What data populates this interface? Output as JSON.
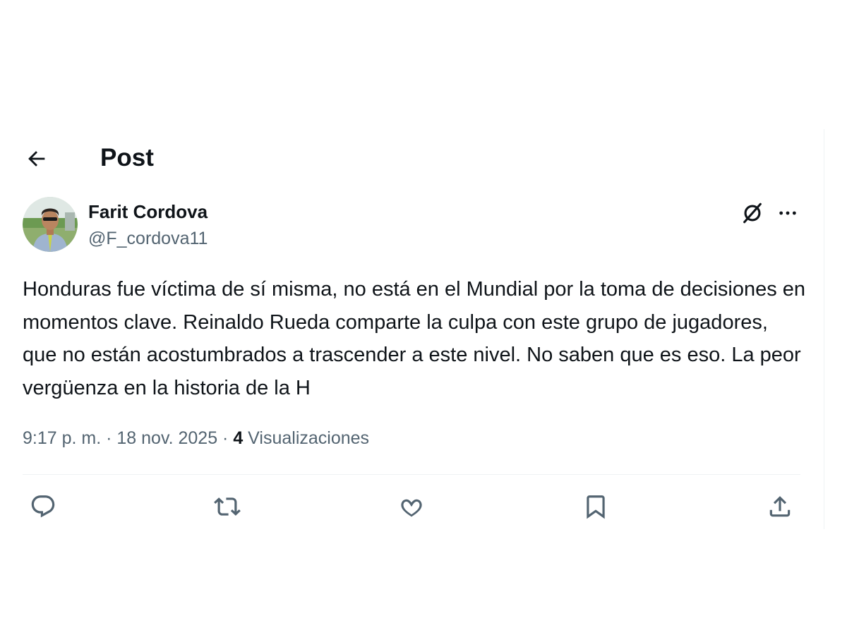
{
  "header": {
    "title": "Post",
    "back_icon": "arrow-left-icon"
  },
  "author": {
    "name": "Farit Cordova",
    "handle": "@F_cordova11",
    "avatar_icon": "profile-photo"
  },
  "tweet": {
    "text": "Honduras fue víctima de sí misma, no está en el Mundial por la toma de decisiones en momentos clave. Reinaldo Rueda comparte la culpa con este grupo de jugadores, que no están acostumbrados a trascender a este nivel. No saben que es eso. La peor vergüenza en la historia de la H",
    "time": "9:17 p. m.",
    "separator": " · ",
    "date": "18 nov. 2025",
    "views_count": "4",
    "views_label": " Visualizaciones"
  },
  "actions": {
    "icons": [
      "reply-icon",
      "repost-icon",
      "like-icon",
      "bookmark-icon",
      "share-icon"
    ]
  },
  "colors": {
    "text_primary": "#0f1419",
    "text_secondary": "#536471",
    "divider": "#eff3f4"
  }
}
